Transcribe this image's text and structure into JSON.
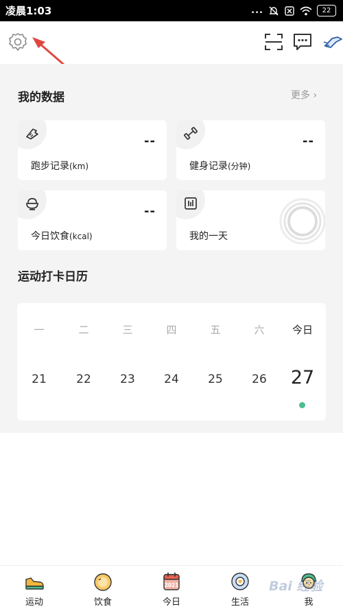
{
  "status_bar": {
    "time": "凌晨1:03",
    "dots": "...",
    "battery": "22"
  },
  "my_data": {
    "title": "我的数据",
    "more": "更多 ›",
    "cards": [
      {
        "label": "跑步记录",
        "unit": "(km)",
        "value": "--",
        "icon": "running-shoe-icon"
      },
      {
        "label": "健身记录",
        "unit": "(分钟)",
        "value": "--",
        "icon": "dumbbell-icon"
      },
      {
        "label": "今日饮食",
        "unit": "(kcal)",
        "value": "--",
        "icon": "bowl-icon"
      },
      {
        "label": "我的一天",
        "unit": "",
        "value": "",
        "icon": "bar-chart-icon"
      }
    ]
  },
  "calendar": {
    "title": "运动打卡日历",
    "weekdays": [
      "一",
      "二",
      "三",
      "四",
      "五",
      "六",
      "今日"
    ],
    "dates": [
      "21",
      "22",
      "23",
      "24",
      "25",
      "26",
      "27"
    ]
  },
  "bottom_nav": [
    {
      "label": "运动",
      "icon": "sneaker-icon"
    },
    {
      "label": "饮食",
      "icon": "fruit-icon"
    },
    {
      "label": "今日",
      "icon": "calendar-2021-icon",
      "badge": "2021"
    },
    {
      "label": "生活",
      "icon": "life-icon"
    },
    {
      "label": "我",
      "icon": "avatar-icon"
    }
  ],
  "watermark": "Bai 经验",
  "colors": {
    "accent_green": "#4dbf8f",
    "annotation_red": "#e0473f",
    "background_gray": "#f4f4f4"
  }
}
